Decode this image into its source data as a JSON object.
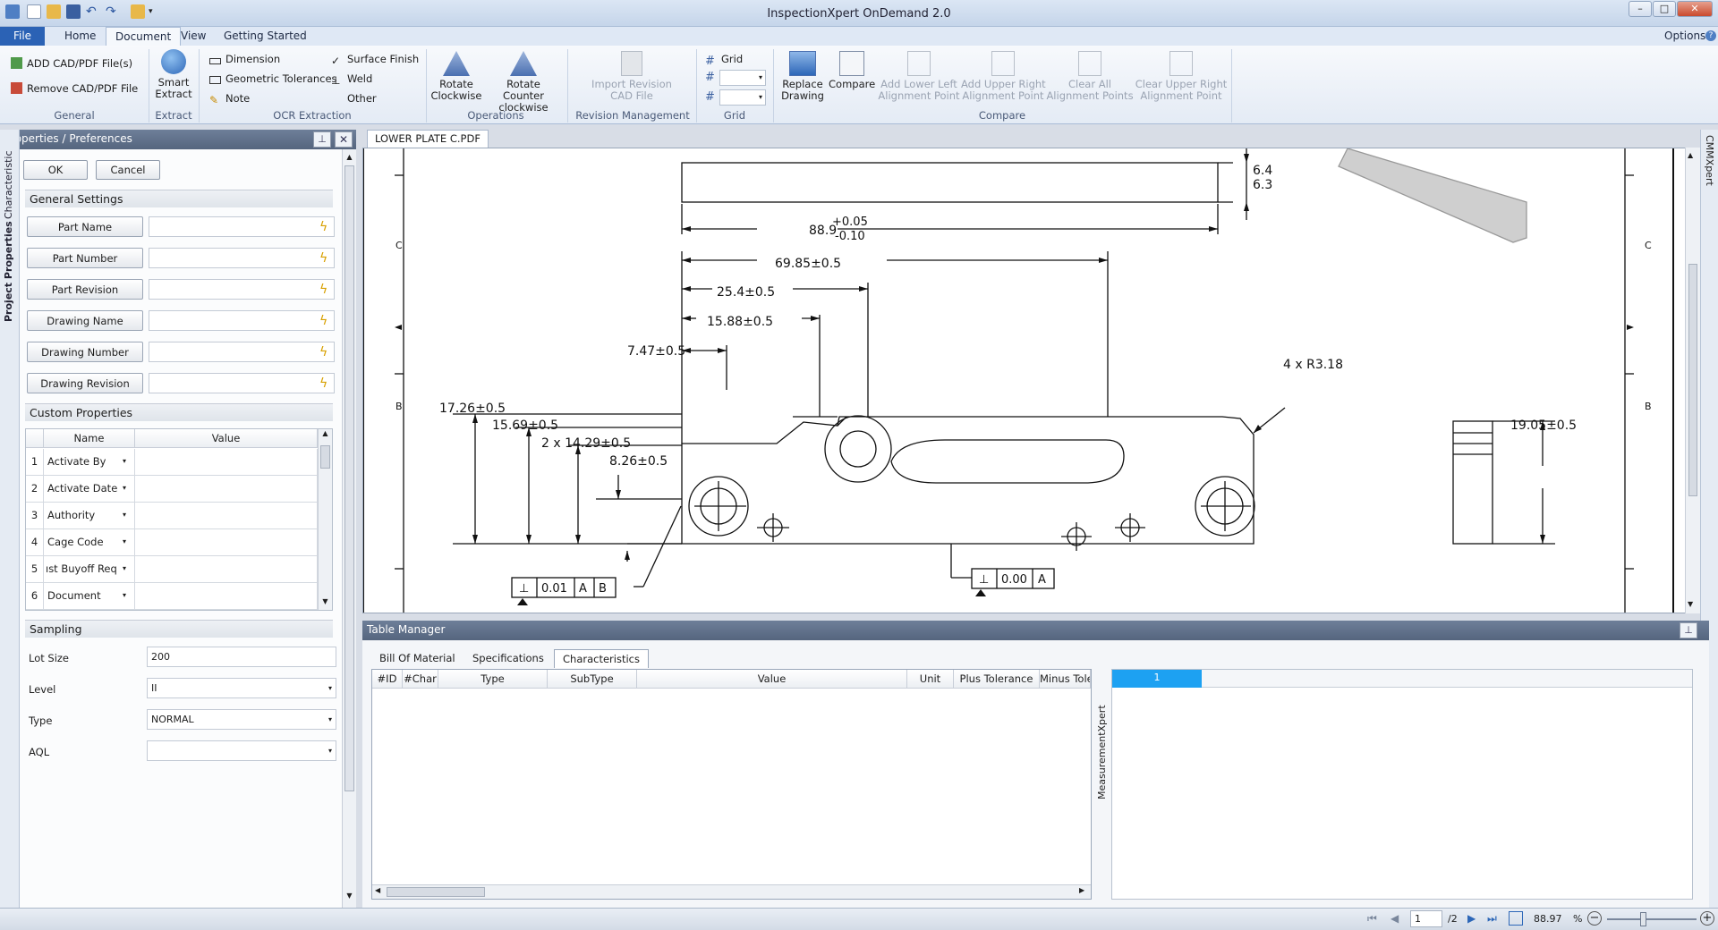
{
  "window": {
    "title": "InspectionXpert OnDemand 2.0",
    "controls": [
      "–",
      "□",
      "✕"
    ],
    "options_label": "Options",
    "help_label": "?"
  },
  "ribbon_tabs": {
    "file": "File",
    "home": "Home",
    "document": "Document",
    "view": "View",
    "getting_started": "Getting Started"
  },
  "ribbon": {
    "general": {
      "label": "General",
      "add": "ADD CAD/PDF File(s)",
      "remove": "Remove CAD/PDF File"
    },
    "extract": {
      "label": "Extract",
      "smart_extract_1": "Smart",
      "smart_extract_2": "Extract"
    },
    "ocr": {
      "label": "OCR Extraction",
      "dimension": "Dimension",
      "geometric": "Geometric Tolerances",
      "note": "Note",
      "surface": "Surface Finish",
      "weld": "Weld",
      "other": "Other"
    },
    "operations": {
      "label": "Operations",
      "rotate_cw_1": "Rotate",
      "rotate_cw_2": "Clockwise",
      "rotate_ccw_1": "Rotate Counter",
      "rotate_ccw_2": "clockwise"
    },
    "revision": {
      "label": "Revision Management",
      "import_1": "Import Revision",
      "import_2": "CAD File"
    },
    "grid": {
      "label": "Grid",
      "grid": "Grid"
    },
    "compare": {
      "label": "Compare",
      "replace_1": "Replace",
      "replace_2": "Drawing",
      "compare": "Compare",
      "add_ll_1": "Add Lower Left",
      "add_ll_2": "Alignment Point",
      "add_ur_1": "Add Upper Right",
      "add_ur_2": "Alignment Point",
      "clear_all_1": "Clear All",
      "clear_all_2": "Alignment Points",
      "clear_ur_1": "Clear Upper Right",
      "clear_ur_2": "Alignment Point"
    }
  },
  "properties_panel": {
    "title": "Properties / Preferences",
    "side_tabs": [
      "Characteristic",
      "Project Properties"
    ],
    "ok": "OK",
    "cancel": "Cancel",
    "general_settings": "General Settings",
    "fields": [
      {
        "label": "Part Name",
        "value": ""
      },
      {
        "label": "Part Number",
        "value": ""
      },
      {
        "label": "Part Revision",
        "value": ""
      },
      {
        "label": "Drawing Name",
        "value": ""
      },
      {
        "label": "Drawing Number",
        "value": ""
      },
      {
        "label": "Drawing Revision",
        "value": ""
      }
    ],
    "custom_properties": "Custom Properties",
    "custom_headers": {
      "name": "Name",
      "value": "Value"
    },
    "custom_rows": [
      {
        "n": "1",
        "name": "Activate By",
        "value": ""
      },
      {
        "n": "2",
        "name": "Activate Date",
        "value": ""
      },
      {
        "n": "3",
        "name": "Authority",
        "value": ""
      },
      {
        "n": "4",
        "name": "Cage Code",
        "value": ""
      },
      {
        "n": "5",
        "name": "ıst Buyoff Req",
        "value": ""
      },
      {
        "n": "6",
        "name": "Document",
        "value": ""
      }
    ],
    "sampling": {
      "title": "Sampling",
      "lot_size_label": "Lot Size",
      "lot_size": "200",
      "level_label": "Level",
      "level": "II",
      "type_label": "Type",
      "type": "NORMAL",
      "aql_label": "AQL",
      "aql": ""
    }
  },
  "document": {
    "tab": "LOWER PLATE C.PDF",
    "right_tab": "CMMXpert",
    "zone_c": "C",
    "zone_b": "B",
    "dims": {
      "thickness_1": "6.4",
      "thickness_2": "6.3",
      "width": "88.9",
      "width_plus": "+0.05",
      "width_minus": "-0.10",
      "d1": "69.85±0.5",
      "d2": "25.4±0.5",
      "d3": "15.88±0.5",
      "d4": "7.47±0.5",
      "d5": "17.26±0.5",
      "d6": "15.69±0.5",
      "d7": "2 x 14.29±0.5",
      "d8": "8.26±0.5",
      "radius": "4 x R3.18",
      "height": "19.05±0.5"
    },
    "fcf1": {
      "value": "0.01",
      "datum1": "A",
      "datum2": "B"
    },
    "fcf2": {
      "value": "0.00",
      "datum1": "A"
    }
  },
  "table_manager": {
    "title": "Table Manager",
    "tabs": [
      "Bill Of Material",
      "Specifications",
      "Characteristics"
    ],
    "columns": [
      "#ID",
      "#Char",
      "Type",
      "SubType",
      "Value",
      "Unit",
      "Plus Tolerance",
      "Minus Toler"
    ],
    "side_label": "MeasurementXpert",
    "grid_header": "1"
  },
  "statusbar": {
    "page": "1",
    "page_total": "/2",
    "zoom": "88.97",
    "zoom_unit": "%"
  }
}
